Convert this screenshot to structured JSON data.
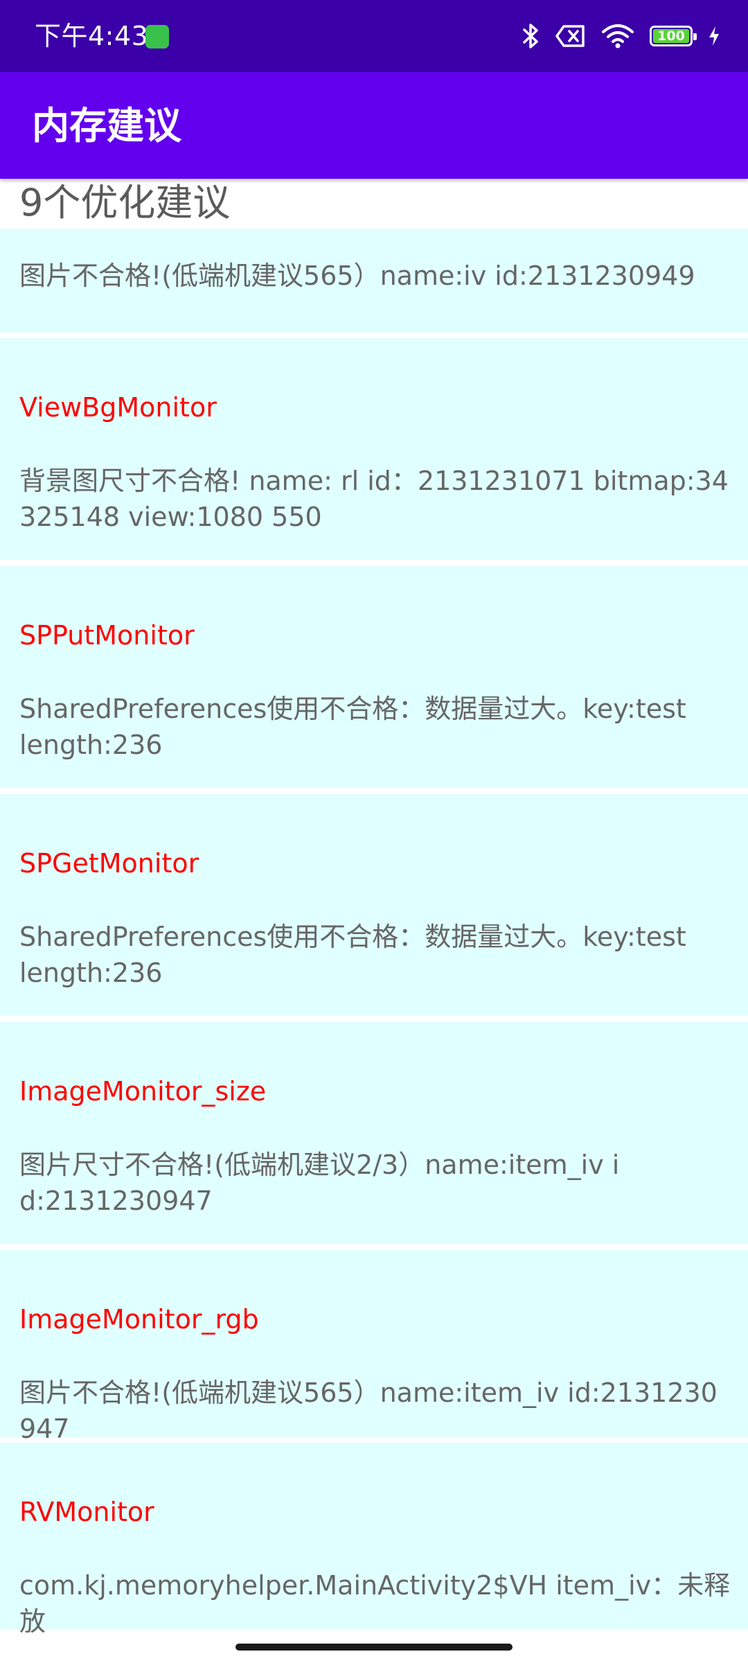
{
  "status_bar": {
    "time": "下午4:43",
    "battery": "100",
    "icons": [
      "bluetooth-icon",
      "sim-off-icon",
      "wifi-icon",
      "battery-icon",
      "charging-icon"
    ],
    "colors": {
      "background": "#3b00a8",
      "app_icon": "#39c24b",
      "battery_fill": "#58d33a"
    }
  },
  "app_bar": {
    "title": "内存建议",
    "color": "#6200ee"
  },
  "summary": "9个优化建议",
  "items": [
    {
      "title": "",
      "message": "图片不合格!(低端机建议565）name:iv id:2131230949"
    },
    {
      "title": "ViewBgMonitor",
      "message": "背景图尺寸不合格! name: rl  id：2131231071 bitmap:34325148 view:1080 550"
    },
    {
      "title": "SPPutMonitor",
      "message": "SharedPreferences使用不合格：数据量过大。key:test length:236"
    },
    {
      "title": "SPGetMonitor",
      "message": "SharedPreferences使用不合格：数据量过大。key:test length:236"
    },
    {
      "title": "ImageMonitor_size",
      "message": "图片尺寸不合格!(低端机建议2/3）name:item_iv id:2131230947"
    },
    {
      "title": "ImageMonitor_rgb",
      "message": "图片不合格!(低端机建议565）name:item_iv id:2131230947"
    },
    {
      "title": "RVMonitor",
      "message": "com.kj.memoryhelper.MainActivity2$VH item_iv：未释放"
    }
  ],
  "colors": {
    "card_background": "#e0ffff",
    "title_text": "#ff0000",
    "message_text": "#666666"
  }
}
